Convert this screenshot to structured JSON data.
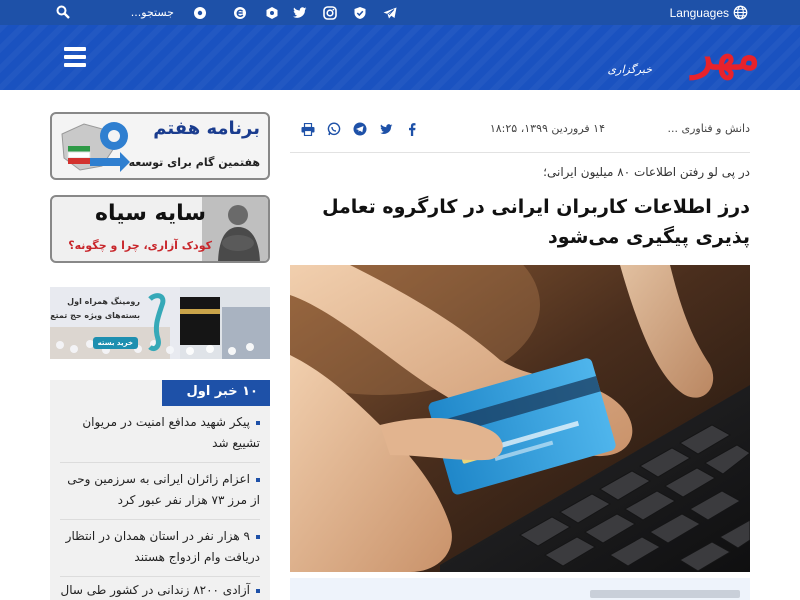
{
  "topbar": {
    "language_label": "Languages",
    "search_placeholder": "جستجو...",
    "social_icons": [
      "telegram-icon",
      "shield-check-icon",
      "instagram-icon",
      "twitter-icon",
      "hexagon-icon",
      "e-icon",
      "ball-icon"
    ]
  },
  "header": {
    "logo_text": "مهر",
    "logo_tagline": "خبرگزاری"
  },
  "article": {
    "section": "دانش و فناوری ...",
    "date": "۱۴ فروردین ۱۳۹۹، ۱۸:۲۵",
    "share_icons": [
      "facebook-icon",
      "twitter-icon",
      "telegram-icon",
      "whatsapp-icon",
      "print-icon"
    ],
    "subtitle": "در پی لو رفتن اطلاعات ۸۰ میلیون ایرانی؛",
    "headline": "درز اطلاعات کاربران ایرانی در کارگروه تعامل پذیری پیگیری می‌شود"
  },
  "ads": {
    "ad1_title": "برنامه هفتم",
    "ad1_subtitle": "هفتمین گام برای توسعه",
    "ad2_title": "سایه سیاه",
    "ad2_subtitle": "کودک آزاری، چرا و چگونه؟",
    "ad3_line1": "رومینگ همراه اول",
    "ad3_line2": "بسته‌های ویژه حج تمتع",
    "ad3_button": "خرید بسته"
  },
  "top10": {
    "title": "۱۰ خبر اول",
    "items": [
      "پیکر شهید مدافع امنیت در مریوان تشییع شد",
      "اعزام زائران ایرانی به سرزمین وحی از مرز ۷۳ هزار نفر عبور کرد",
      "۹ هزار نفر در استان همدان در انتظار دریافت وام ازدواج هستند",
      "آزادی ۸۲۰۰ زندانی در کشور طی سال"
    ]
  },
  "colors": {
    "topbar": "#1e51a8",
    "header": "#1a52c0",
    "logo_red": "#e8222b",
    "accent": "#1e51a8"
  }
}
